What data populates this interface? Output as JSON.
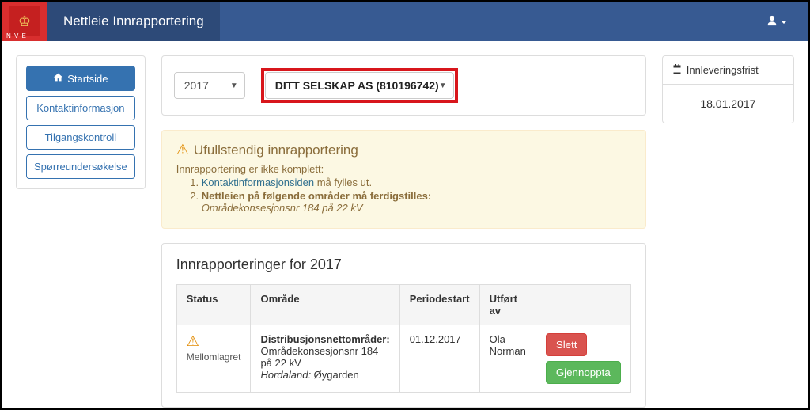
{
  "navbar": {
    "logo_text": "N V E",
    "brand": "Nettleie Innrapportering"
  },
  "sidebar": {
    "startside": "Startside",
    "kontakt": "Kontaktinformasjon",
    "tilgang": "Tilgangskontroll",
    "sporre": "Spørreundersøkelse"
  },
  "filters": {
    "year": "2017",
    "company": "DITT SELSKAP AS (810196742)"
  },
  "alert": {
    "title": "Ufullstendig innrapportering",
    "intro": "Innrapportering er ikke komplett:",
    "item1_link": "Kontaktinformasjonsiden",
    "item1_rest": " må fylles ut.",
    "item2_bold": "Nettleien på følgende områder må ferdigstilles:",
    "item2_detail": "Områdekonsesjonsnr 184 på 22 kV"
  },
  "reports": {
    "heading": "Innrapporteringer for 2017",
    "col_status": "Status",
    "col_omrade": "Område",
    "col_periode": "Periodestart",
    "col_utfort": "Utført av",
    "rows": [
      {
        "status": "Mellomlagret",
        "omrade_title": "Distribusjonsnettområder:",
        "omrade_line1": "Områdekonsesjonsnr 184 på 22 kV",
        "omrade_loc_county": "Hordaland:",
        "omrade_loc_place": " Øygarden",
        "periodestart": "01.12.2017",
        "utfort_av": "Ola Norman",
        "btn_slett": "Slett",
        "btn_gjenoppta": "Gjennoppta"
      }
    ]
  },
  "deadline": {
    "label": "Innleveringsfrist",
    "date": "18.01.2017"
  }
}
